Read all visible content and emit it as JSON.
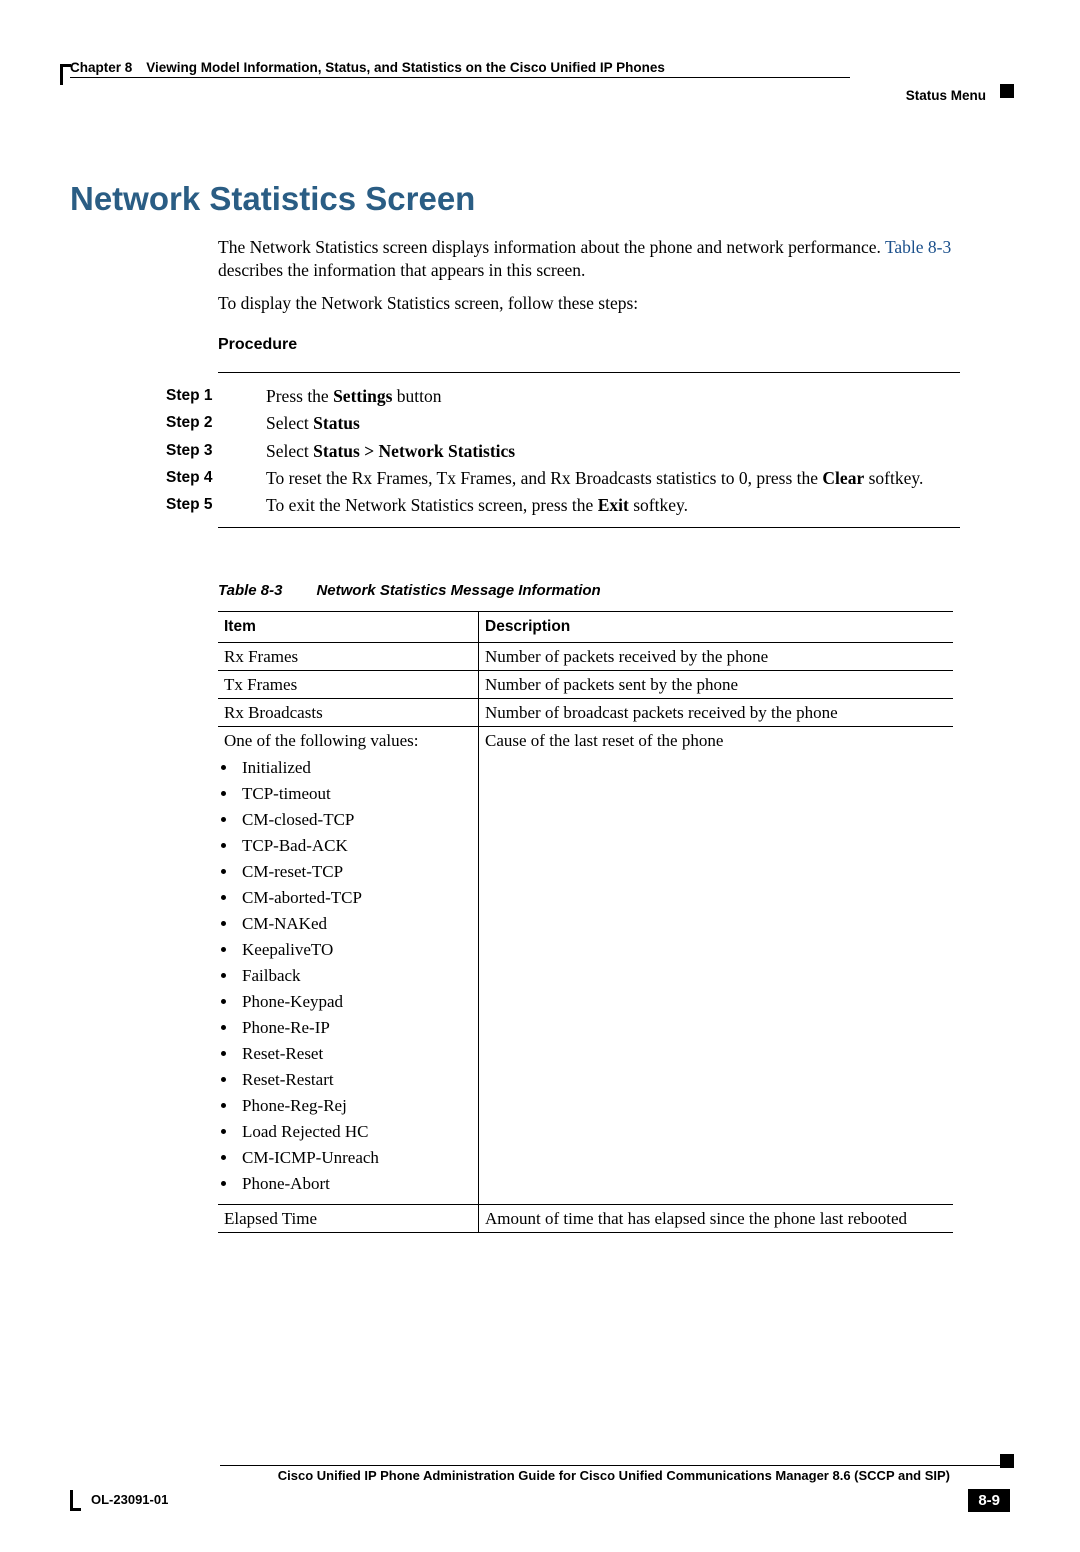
{
  "header": {
    "chapter_num": "Chapter 8",
    "chapter_title": "Viewing Model Information, Status, and Statistics on the Cisco Unified IP Phones",
    "section_label": "Status Menu"
  },
  "title": "Network Statistics Screen",
  "body": {
    "p1_a": "The Network Statistics screen displays information about the phone and network performance. ",
    "p1_link": "Table 8-3",
    "p1_b": " describes the information that appears in this screen.",
    "p2": "To display the Network Statistics screen, follow these steps:",
    "procedure_label": "Procedure"
  },
  "steps": [
    {
      "label": "Step 1",
      "prefix": "Press the ",
      "bold": "Settings",
      "suffix": " button"
    },
    {
      "label": "Step 2",
      "prefix": "Select ",
      "bold": "Status",
      "suffix": ""
    },
    {
      "label": "Step 3",
      "prefix": "Select ",
      "bold": "Status > Network Statistics",
      "suffix": ""
    },
    {
      "label": "Step 4",
      "prefix": "To reset the Rx Frames, Tx Frames, and Rx Broadcasts statistics to 0, press the ",
      "bold": "Clear",
      "suffix": " softkey."
    },
    {
      "label": "Step 5",
      "prefix": "To exit the Network Statistics screen, press the ",
      "bold": "Exit",
      "suffix": " softkey."
    }
  ],
  "table": {
    "caption_num": "Table 8-3",
    "caption_title": "Network Statistics Message Information",
    "head_item": "Item",
    "head_desc": "Description",
    "rows": [
      {
        "item": "Rx Frames",
        "desc": "Number of packets received by the phone"
      },
      {
        "item": "Tx Frames",
        "desc": "Number of packets sent by the phone"
      },
      {
        "item": "Rx Broadcasts",
        "desc": "Number of broadcast packets received by the phone"
      }
    ],
    "reset_row": {
      "item_intro": "One of the following values:",
      "values": [
        "Initialized",
        "TCP-timeout",
        "CM-closed-TCP",
        "TCP-Bad-ACK",
        "CM-reset-TCP",
        "CM-aborted-TCP",
        "CM-NAKed",
        "KeepaliveTO",
        "Failback",
        "Phone-Keypad",
        "Phone-Re-IP",
        "Reset-Reset",
        "Reset-Restart",
        "Phone-Reg-Rej",
        "Load Rejected HC",
        "CM-ICMP-Unreach",
        "Phone-Abort"
      ],
      "desc": "Cause of the last reset of the phone"
    },
    "last_row": {
      "item": "Elapsed Time",
      "desc": "Amount of time that has elapsed since the phone last rebooted"
    }
  },
  "footer": {
    "guide_title": "Cisco Unified IP Phone Administration Guide for Cisco Unified Communications Manager 8.6 (SCCP and SIP)",
    "doc_id": "OL-23091-01",
    "page_num": "8-9"
  }
}
